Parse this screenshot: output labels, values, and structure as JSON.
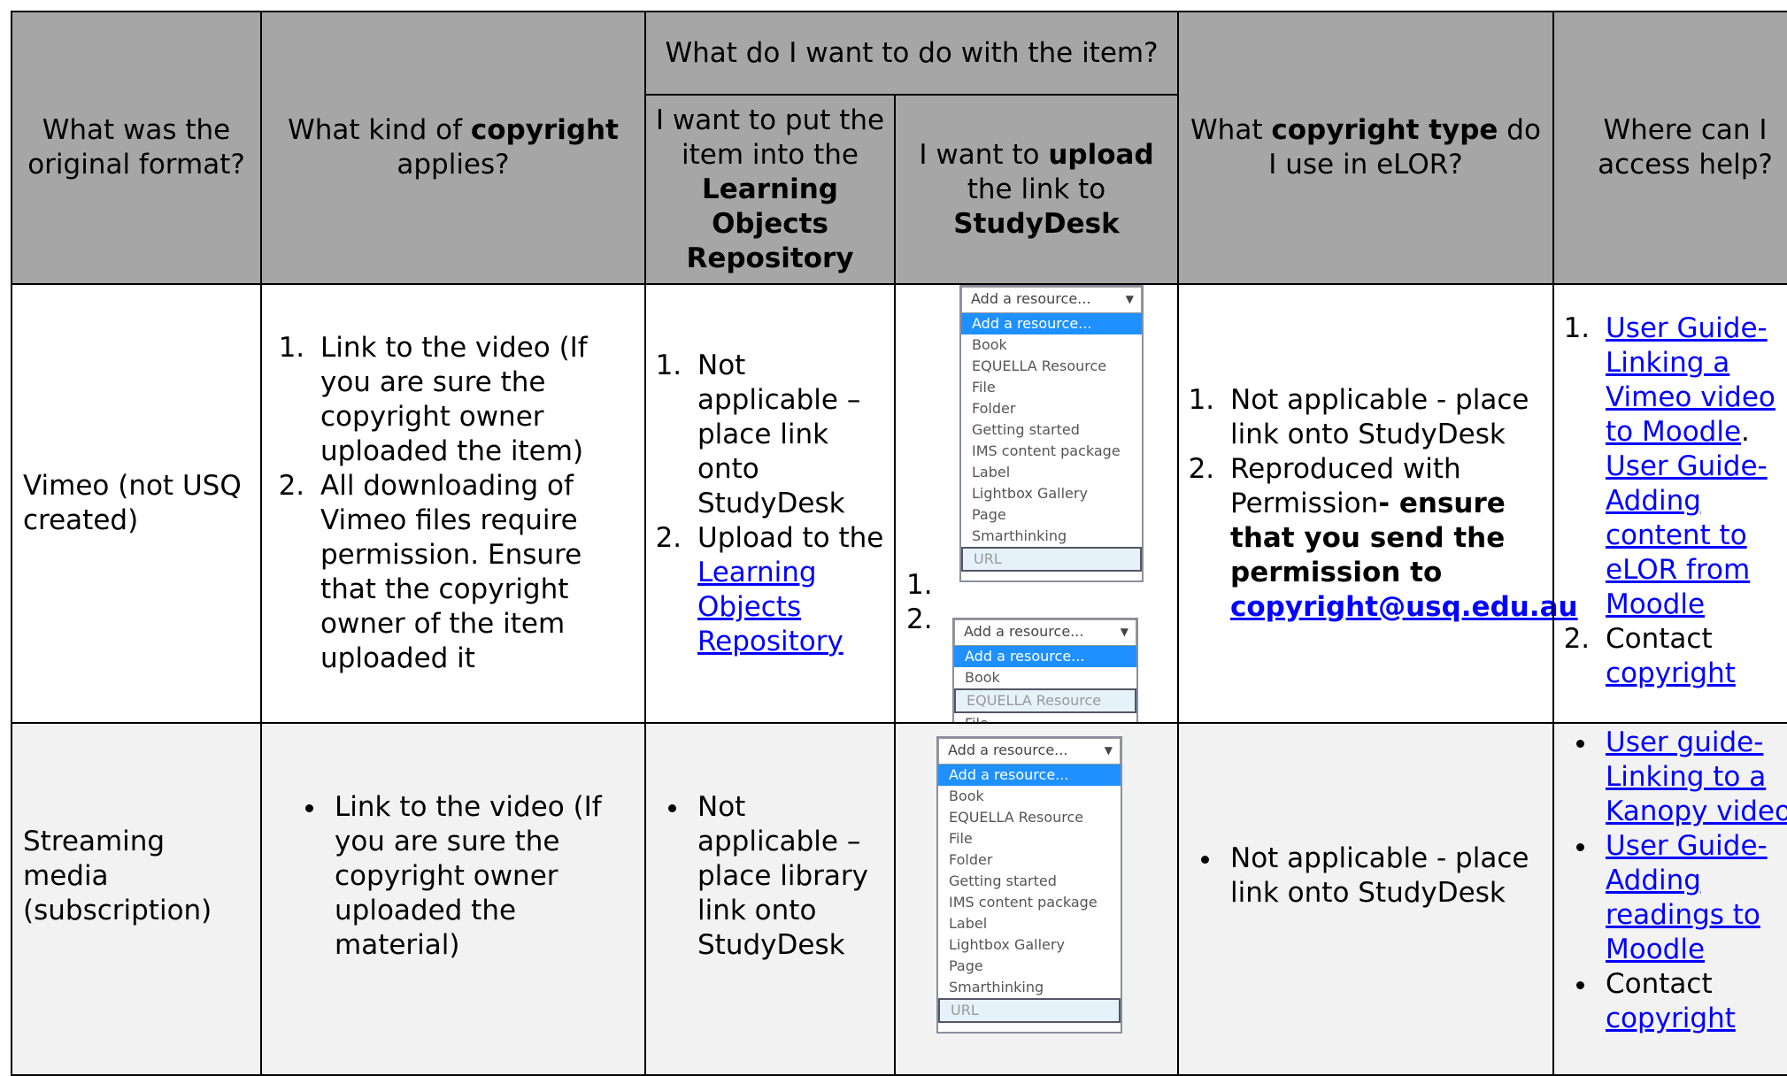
{
  "header": {
    "col1": "What was the original format?",
    "col2_pre": "What kind of ",
    "col2_bold": "copyright",
    "col2_post": " applies?",
    "group": "What do I want to do with the item?",
    "col3_pre": "I want to put the item into the ",
    "col3_bold": "Learning Objects Repository",
    "col4_pre": "I want to ",
    "col4_bold1": "upload",
    "col4_mid": " the link to ",
    "col4_bold2": "StudyDesk",
    "col5_pre": "What ",
    "col5_bold": "copyright type",
    "col5_post": " do I use in eLOR?",
    "col6": "Where can I access help?"
  },
  "rows": [
    {
      "format": "Vimeo (not USQ created)",
      "copyright": [
        "Link to the video (If you are sure the copyright owner uploaded the item)",
        "All downloading of Vimeo files require permission. Ensure that the copyright owner of the item uploaded it"
      ],
      "lor_1": "Not applicable – place link onto StudyDesk",
      "lor_2_pre": "Upload to the ",
      "lor_2_link": "Learning Objects Repository",
      "upload_nums": [
        "1.",
        "2."
      ],
      "type_1": "Not applicable - place link onto StudyDesk",
      "type_2_pre": "Reproduced with Permission",
      "type_2_bold": "- ensure that you send the permission to ",
      "type_2_email": "copyright@usq.edu.au",
      "help_1a": "User Guide- Linking a Vimeo video to Moodle",
      "help_1_sep": ".",
      "help_1b": "User Guide- Adding content to eLOR from Moodle",
      "help_2_pre": "Contact ",
      "help_2_link": "copyright"
    },
    {
      "format": "Streaming media (subscription)",
      "copyright": "Link to the video (If you are sure the copyright owner uploaded the material)",
      "lor": "Not applicable – place library link onto StudyDesk",
      "type": "Not applicable - place link onto StudyDesk",
      "help_1": "User guide- Linking to a Kanopy video",
      "help_2": "User Guide- Adding readings to Moodle",
      "help_3_pre": "Contact ",
      "help_3_link": "copyright"
    }
  ],
  "dropdown": {
    "placeholder": "Add a resource...",
    "options_full": [
      "Add a resource...",
      "Book",
      "EQUELLA Resource",
      "File",
      "Folder",
      "Getting started",
      "IMS content package",
      "Label",
      "Lightbox Gallery",
      "Page",
      "Smarthinking",
      "URL"
    ],
    "options_short": [
      "Add a resource...",
      "Book",
      "EQUELLA Resource",
      "File"
    ]
  }
}
